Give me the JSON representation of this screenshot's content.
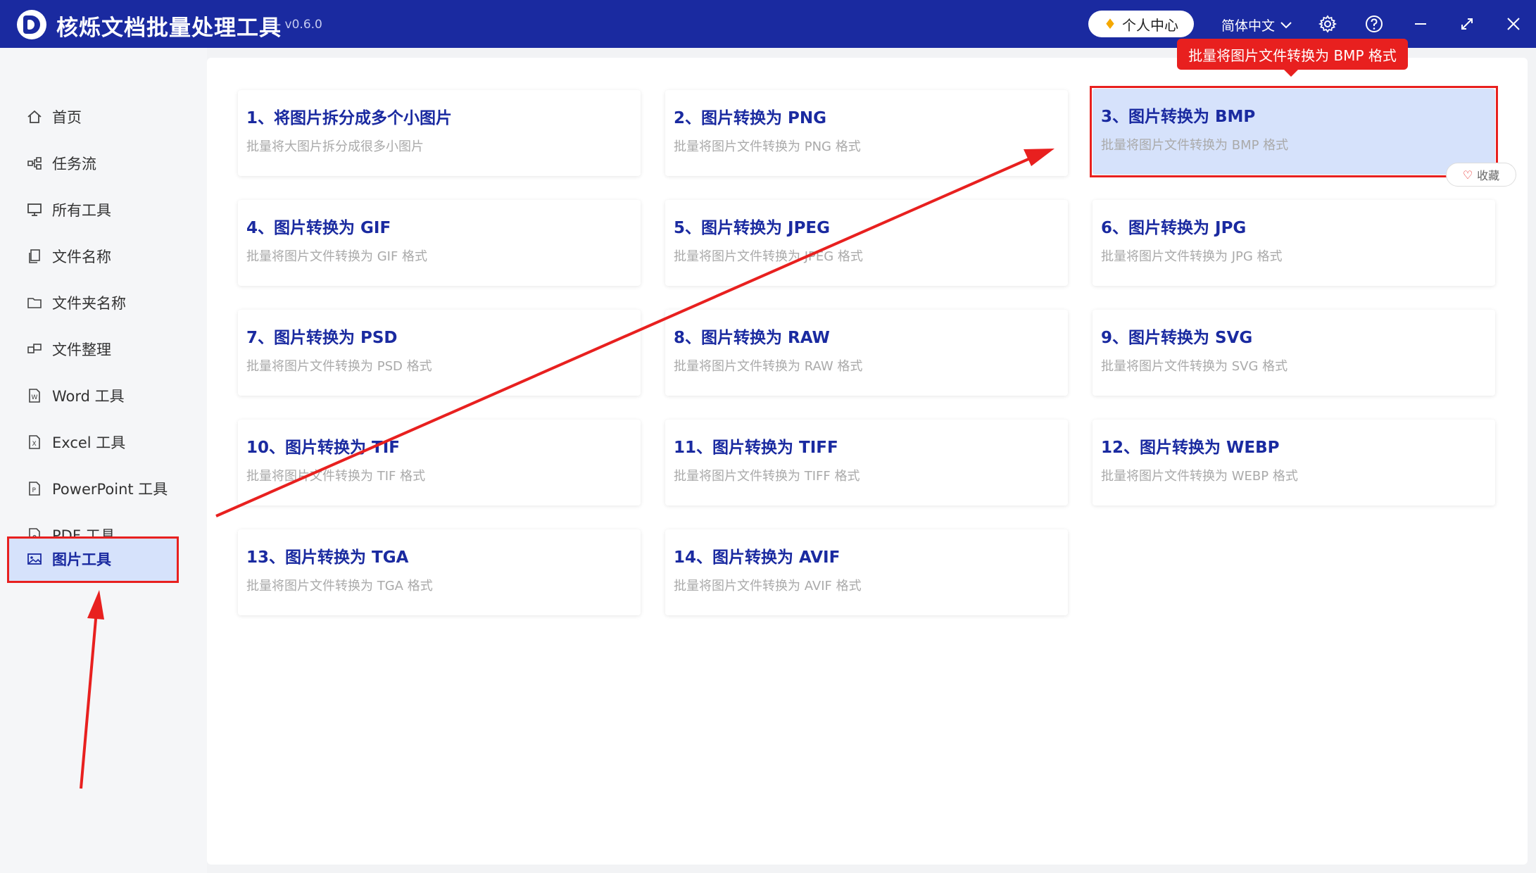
{
  "app": {
    "title": "核烁文档批量处理工具",
    "version": "- v0.6.0",
    "vip_label": "个人中心",
    "language": "简体中文"
  },
  "sidebar": {
    "items": [
      {
        "label": "首页",
        "icon": "home-icon"
      },
      {
        "label": "任务流",
        "icon": "workflow-icon"
      },
      {
        "label": "所有工具",
        "icon": "monitor-icon"
      },
      {
        "label": "文件名称",
        "icon": "file-copy-icon"
      },
      {
        "label": "文件夹名称",
        "icon": "folder-icon"
      },
      {
        "label": "文件整理",
        "icon": "organize-icon"
      },
      {
        "label": "Word 工具",
        "icon": "word-icon"
      },
      {
        "label": "Excel 工具",
        "icon": "excel-icon"
      },
      {
        "label": "PowerPoint 工具",
        "icon": "powerpoint-icon"
      },
      {
        "label": "PDF 工具",
        "icon": "pdf-icon"
      },
      {
        "label": "图片工具",
        "icon": "image-icon",
        "active": true
      }
    ]
  },
  "tools": [
    {
      "title": "1、将图片拆分成多个小图片",
      "desc": "批量将大图片拆分成很多小图片"
    },
    {
      "title": "2、图片转换为 PNG",
      "desc": "批量将图片文件转换为 PNG 格式"
    },
    {
      "title": "3、图片转换为 BMP",
      "desc": "批量将图片文件转换为 BMP 格式"
    },
    {
      "title": "4、图片转换为 GIF",
      "desc": "批量将图片文件转换为 GIF 格式"
    },
    {
      "title": "5、图片转换为 JPEG",
      "desc": "批量将图片文件转换为 JPEG 格式"
    },
    {
      "title": "6、图片转换为 JPG",
      "desc": "批量将图片文件转换为 JPG 格式"
    },
    {
      "title": "7、图片转换为 PSD",
      "desc": "批量将图片文件转换为 PSD 格式"
    },
    {
      "title": "8、图片转换为 RAW",
      "desc": "批量将图片文件转换为 RAW 格式"
    },
    {
      "title": "9、图片转换为 SVG",
      "desc": "批量将图片文件转换为 SVG 格式"
    },
    {
      "title": "10、图片转换为 TIF",
      "desc": "批量将图片文件转换为 TIF 格式"
    },
    {
      "title": "11、图片转换为 TIFF",
      "desc": "批量将图片文件转换为 TIFF 格式"
    },
    {
      "title": "12、图片转换为 WEBP",
      "desc": "批量将图片文件转换为 WEBP 格式"
    },
    {
      "title": "13、图片转换为 TGA",
      "desc": "批量将图片文件转换为 TGA 格式"
    },
    {
      "title": "14、图片转换为 AVIF",
      "desc": "批量将图片文件转换为 AVIF 格式"
    }
  ],
  "tooltip": "批量将图片文件转换为 BMP 格式",
  "favorite_label": "收藏",
  "colors": {
    "brand": "#1a2aa0",
    "annotation": "#e8201f",
    "active_bg": "#d6e2fb"
  }
}
